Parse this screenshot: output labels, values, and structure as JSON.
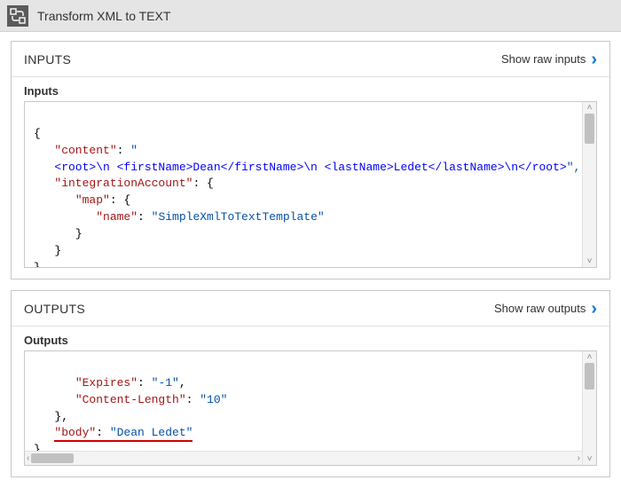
{
  "titlebar": {
    "title": "Transform XML to TEXT"
  },
  "inputs": {
    "header": "INPUTS",
    "show_raw": "Show raw inputs",
    "sub": "Inputs",
    "json": {
      "content_key": "\"content\"",
      "content_open": "\"",
      "content_xml": "<root>\\n <firstName>Dean</firstName>\\n <lastName>Ledet</lastName>\\n</root>",
      "content_close": "\",",
      "integration_key": "\"integrationAccount\"",
      "map_key": "\"map\"",
      "name_key": "\"name\"",
      "name_val": "\"SimpleXmlToTextTemplate\""
    }
  },
  "outputs": {
    "header": "OUTPUTS",
    "show_raw": "Show raw outputs",
    "sub": "Outputs",
    "json": {
      "expires_key": "\"Expires\"",
      "expires_val": "\"-1\"",
      "clen_key": "\"Content-Length\"",
      "clen_val": "\"10\"",
      "body_key": "\"body\"",
      "body_val": "\"Dean Ledet\""
    }
  },
  "glyphs": {
    "chev_right": "›",
    "tri_up": "˄",
    "tri_down": "˅",
    "tri_left": "‹",
    "tri_right": "›"
  }
}
